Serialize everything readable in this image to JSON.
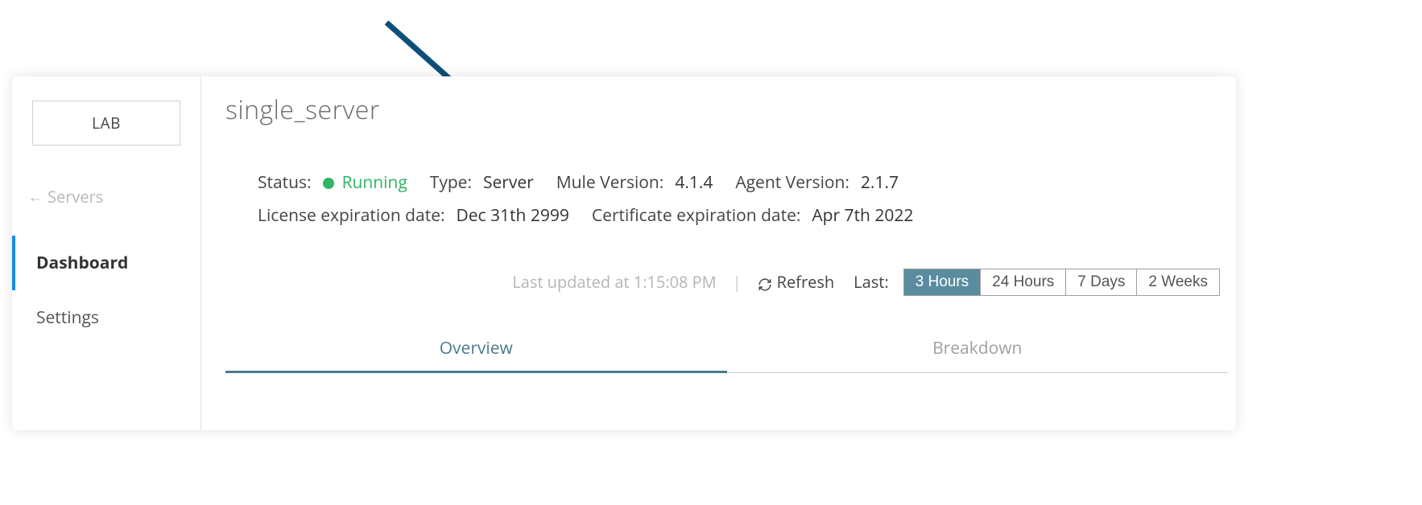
{
  "sidebar": {
    "env_label": "LAB",
    "back_label": "Servers",
    "nav": [
      {
        "label": "Dashboard",
        "active": true
      },
      {
        "label": "Settings",
        "active": false
      }
    ]
  },
  "header": {
    "title": "single_server"
  },
  "info": {
    "status_label": "Status:",
    "status_value": "Running",
    "type_label": "Type:",
    "type_value": "Server",
    "mule_version_label": "Mule Version:",
    "mule_version_value": "4.1.4",
    "agent_version_label": "Agent Version:",
    "agent_version_value": "2.1.7",
    "license_exp_label": "License expiration date:",
    "license_exp_value": "Dec 31th 2999",
    "cert_exp_label": "Certificate expiration date:",
    "cert_exp_value": "Apr 7th 2022"
  },
  "toolbar": {
    "last_updated": "Last updated at 1:15:08 PM",
    "divider": "|",
    "refresh_label": "Refresh",
    "last_label": "Last:",
    "ranges": [
      "3 Hours",
      "24 Hours",
      "7 Days",
      "2 Weeks"
    ],
    "active_range": "3 Hours"
  },
  "tabs": [
    {
      "label": "Overview",
      "active": true
    },
    {
      "label": "Breakdown",
      "active": false
    }
  ],
  "colors": {
    "accent": "#178bea",
    "status_green": "#2fb566",
    "tab_active": "#4a7a8f",
    "range_active_bg": "#5a8ca0",
    "annotation_arrow": "#0d4f7a"
  }
}
